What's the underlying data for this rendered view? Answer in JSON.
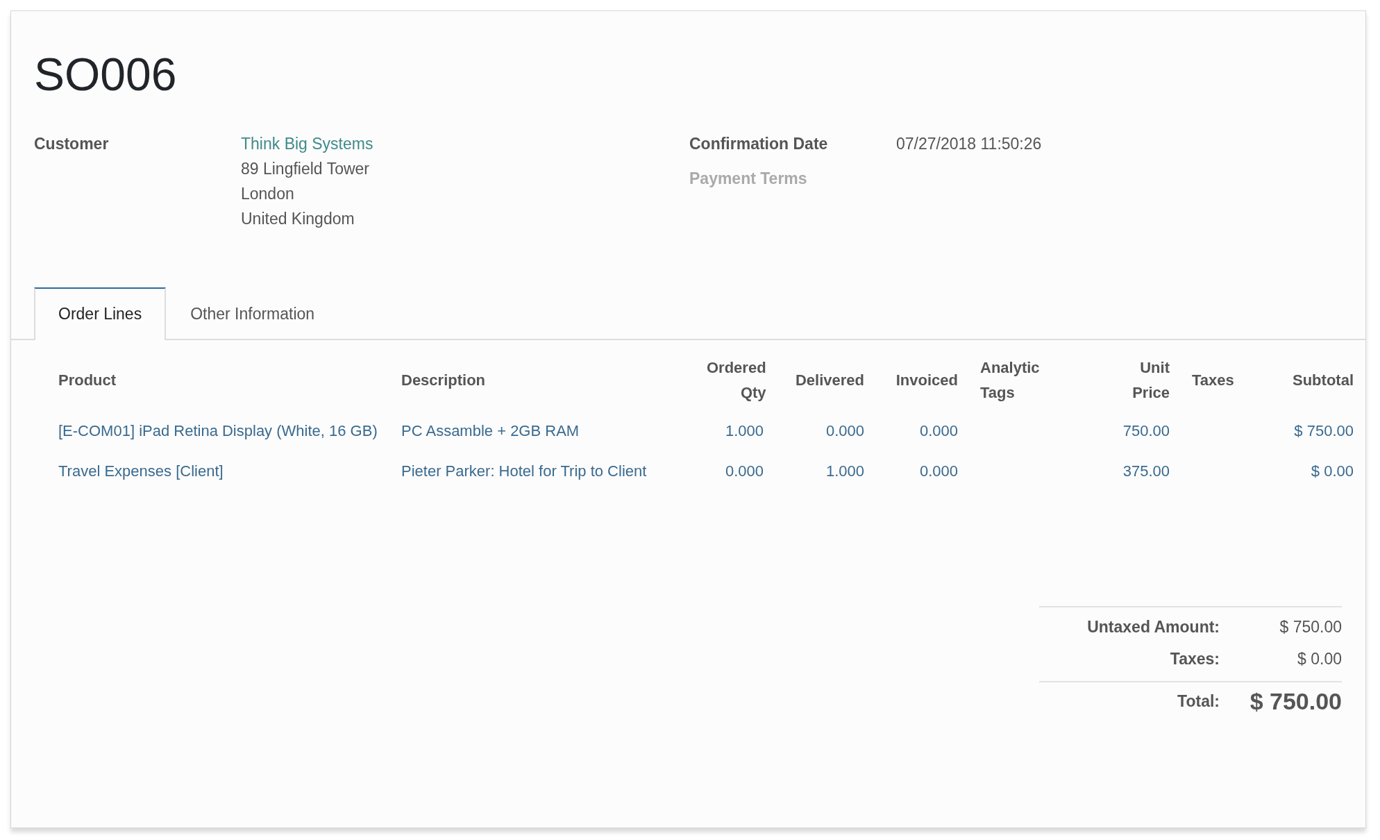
{
  "title": "SO006",
  "fields_left": [
    {
      "label": "Customer",
      "empty": false,
      "link": "Think Big Systems",
      "lines": [
        "89 Lingfield Tower",
        "London",
        "United Kingdom"
      ]
    }
  ],
  "fields_right": [
    {
      "label": "Confirmation Date",
      "empty": false,
      "value": "07/27/2018 11:50:26"
    },
    {
      "label": "Payment Terms",
      "empty": true
    }
  ],
  "tabs": [
    {
      "label": "Order Lines",
      "selected": true
    },
    {
      "label": "Other Information",
      "selected": false
    }
  ],
  "table": {
    "columns": [
      {
        "label": "Product",
        "kind": "text"
      },
      {
        "label": "Description",
        "kind": "text"
      },
      {
        "label": "Ordered Qty",
        "kind": "number"
      },
      {
        "label": "Delivered",
        "kind": "number"
      },
      {
        "label": "Invoiced",
        "kind": "number"
      },
      {
        "label": "Analytic Tags",
        "kind": "text"
      },
      {
        "label": "Unit Price",
        "kind": "number"
      },
      {
        "label": "Taxes",
        "kind": "text"
      },
      {
        "label": "Subtotal",
        "kind": "number"
      }
    ],
    "rows": [
      {
        "cells": [
          "[E-COM01] iPad Retina Display (White, 16 GB)",
          "PC Assamble + 2GB RAM",
          "1.000",
          "0.000",
          "0.000",
          "",
          "750.00",
          "",
          "$ 750.00"
        ]
      },
      {
        "cells": [
          "Travel Expenses [Client]",
          "Pieter Parker: Hotel for Trip to Client",
          "0.000",
          "1.000",
          "0.000",
          "",
          "375.00",
          "",
          "$ 0.00"
        ]
      }
    ]
  },
  "totals": [
    {
      "label": "Untaxed Amount:",
      "value": "$ 750.00",
      "kind": "sub"
    },
    {
      "label": "Taxes:",
      "value": "$ 0.00",
      "kind": "sub"
    },
    {
      "label": "Total:",
      "value": "$ 750.00",
      "kind": "grand"
    }
  ]
}
